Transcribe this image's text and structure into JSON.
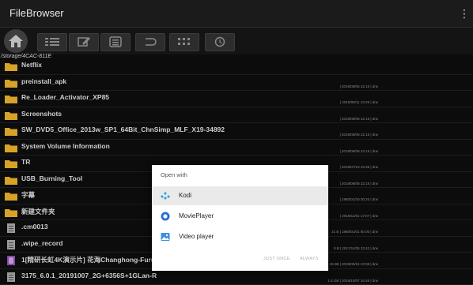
{
  "app": {
    "title": "FileBrowser",
    "overflow_glyph": "⋮"
  },
  "toolbar": {
    "buttons": [
      "home-icon",
      "list-view-icon",
      "edit-icon",
      "multiselect-icon",
      "back-icon",
      "grid-view-icon",
      "clock-icon"
    ]
  },
  "path": "/storage/4CAC-811E",
  "rows": [
    {
      "name": "Netflix",
      "meta": "",
      "type": "folder"
    },
    {
      "name": "preinstall_apk",
      "meta": "| 2019/08/06 22:15 | drw",
      "type": "folder"
    },
    {
      "name": "Re_Loader_Activator_XP85",
      "meta": "| 2019/08/11 10:29 | drw",
      "type": "folder"
    },
    {
      "name": "Screenshots",
      "meta": "| 2019/08/08 22:15 | drw",
      "type": "folder"
    },
    {
      "name": "SW_DVD5_Office_2013w_SP1_64Bit_ChnSimp_MLF_X19-34892",
      "meta": "| 2019/08/08 22:15 | drw",
      "type": "folder"
    },
    {
      "name": "System Volume Information",
      "meta": "| 2019/08/08 22:15 | drw",
      "type": "folder"
    },
    {
      "name": "TR",
      "meta": "| 2019/07/10 23:35 | drw",
      "type": "folder"
    },
    {
      "name": "USB_Burning_Tool",
      "meta": "| 2019/08/08 22:15 | drw",
      "type": "folder"
    },
    {
      "name": "字幕",
      "meta": "| 1980/01/30 00:20 | drw",
      "type": "folder"
    },
    {
      "name": "新建文件夹",
      "meta": "| 2019/11/01 17:07 | drw",
      "type": "folder"
    },
    {
      "name": ".cm0013",
      "meta": "21 B | 1980/01/01 00:00 | drw",
      "type": "file"
    },
    {
      "name": ".wipe_record",
      "meta": "0 B | 2017/11/05 22:42 | drw",
      "type": "file"
    },
    {
      "name": "1[精研长虹4K演示片] 花海Changhong-Furu",
      "meta": "28.0B | 2019/08/15 23:08 | drw",
      "type": "image"
    },
    {
      "name": "3175_6.0.1_20191007_2G+6356S+1GLan-R",
      "meta": "1.5 GB | 2019/10/07 16:46 | drw",
      "type": "file"
    }
  ],
  "dialog": {
    "title": "Open with",
    "options": [
      {
        "label": "Kodi",
        "icon": "kodi-icon",
        "selected": true
      },
      {
        "label": "MoviePlayer",
        "icon": "movieplayer-icon",
        "selected": false
      },
      {
        "label": "Video player",
        "icon": "video-player-icon",
        "selected": false
      }
    ],
    "just_once": "JUST ONCE",
    "always": "ALWAYS"
  },
  "colors": {
    "folder": "#d6a227",
    "kodi": "#2fa3dc",
    "movieplayer": "#2a6fd1",
    "videoplayer": "#3d8fe0"
  }
}
